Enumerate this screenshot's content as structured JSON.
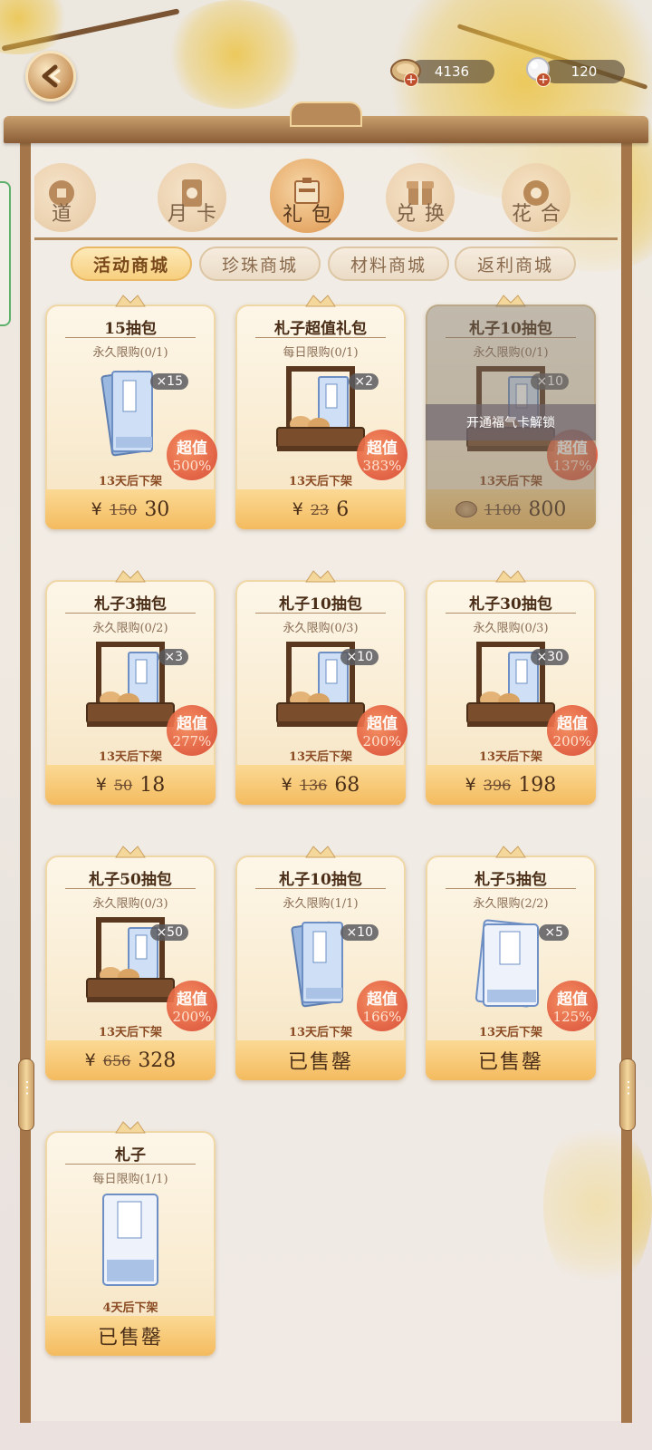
{
  "currencies": [
    {
      "name": "coin",
      "value": "4136",
      "icon": "coin-icon"
    },
    {
      "name": "pearl",
      "value": "120",
      "icon": "pearl-icon"
    }
  ],
  "categories": [
    {
      "label": "道",
      "icon": "coin-cat-icon",
      "active": false
    },
    {
      "label": "月卡",
      "icon": "card-cat-icon",
      "active": false
    },
    {
      "label": "礼包",
      "icon": "gift-pack-icon",
      "active": true
    },
    {
      "label": "兑换",
      "icon": "exchange-icon",
      "active": false
    },
    {
      "label": "花合",
      "icon": "flower-icon",
      "active": false
    }
  ],
  "subtabs": [
    {
      "label": "活动商城",
      "active": true
    },
    {
      "label": "珍珠商城",
      "active": false
    },
    {
      "label": "材料商城",
      "active": false
    },
    {
      "label": "返利商城",
      "active": false
    }
  ],
  "lock_text": "开通福气卡解锁",
  "products": [
    {
      "title": "15抽包",
      "limit": "永久限购(0/1)",
      "qty": "×15",
      "badge": "超值",
      "pct": "500%",
      "expire": "13天后下架",
      "cur": "¥",
      "old": "150",
      "new": "30",
      "img": "book"
    },
    {
      "title": "札子超值礼包",
      "limit": "每日限购(0/1)",
      "qty": "×2",
      "badge": "超值",
      "pct": "383%",
      "expire": "13天后下架",
      "cur": "¥",
      "old": "23",
      "new": "6",
      "img": "basket"
    },
    {
      "title": "札子10抽包",
      "limit": "永久限购(0/1)",
      "qty": "×10",
      "badge": "超值",
      "pct": "137%",
      "expire": "13天后下架",
      "cur": "",
      "old": "1100",
      "new": "800",
      "img": "basket",
      "locked": true
    },
    {
      "title": "札子3抽包",
      "limit": "永久限购(0/2)",
      "qty": "×3",
      "badge": "超值",
      "pct": "277%",
      "expire": "13天后下架",
      "cur": "¥",
      "old": "50",
      "new": "18",
      "img": "basket"
    },
    {
      "title": "札子10抽包",
      "limit": "永久限购(0/3)",
      "qty": "×10",
      "badge": "超值",
      "pct": "200%",
      "expire": "13天后下架",
      "cur": "¥",
      "old": "136",
      "new": "68",
      "img": "basket"
    },
    {
      "title": "札子30抽包",
      "limit": "永久限购(0/3)",
      "qty": "×30",
      "badge": "超值",
      "pct": "200%",
      "expire": "13天后下架",
      "cur": "¥",
      "old": "396",
      "new": "198",
      "img": "basket"
    },
    {
      "title": "札子50抽包",
      "limit": "永久限购(0/3)",
      "qty": "×50",
      "badge": "超值",
      "pct": "200%",
      "expire": "13天后下架",
      "cur": "¥",
      "old": "656",
      "new": "328",
      "img": "basket"
    },
    {
      "title": "札子10抽包",
      "limit": "永久限购(1/1)",
      "qty": "×10",
      "badge": "超值",
      "pct": "166%",
      "expire": "13天后下架",
      "soldout": "已售罄",
      "img": "book"
    },
    {
      "title": "札子5抽包",
      "limit": "永久限购(2/2)",
      "qty": "×5",
      "badge": "超值",
      "pct": "125%",
      "expire": "13天后下架",
      "soldout": "已售罄",
      "img": "scroll"
    },
    {
      "title": "札子",
      "limit": "每日限购(1/1)",
      "expire": "4天后下架",
      "soldout": "已售罄",
      "img": "single"
    }
  ]
}
